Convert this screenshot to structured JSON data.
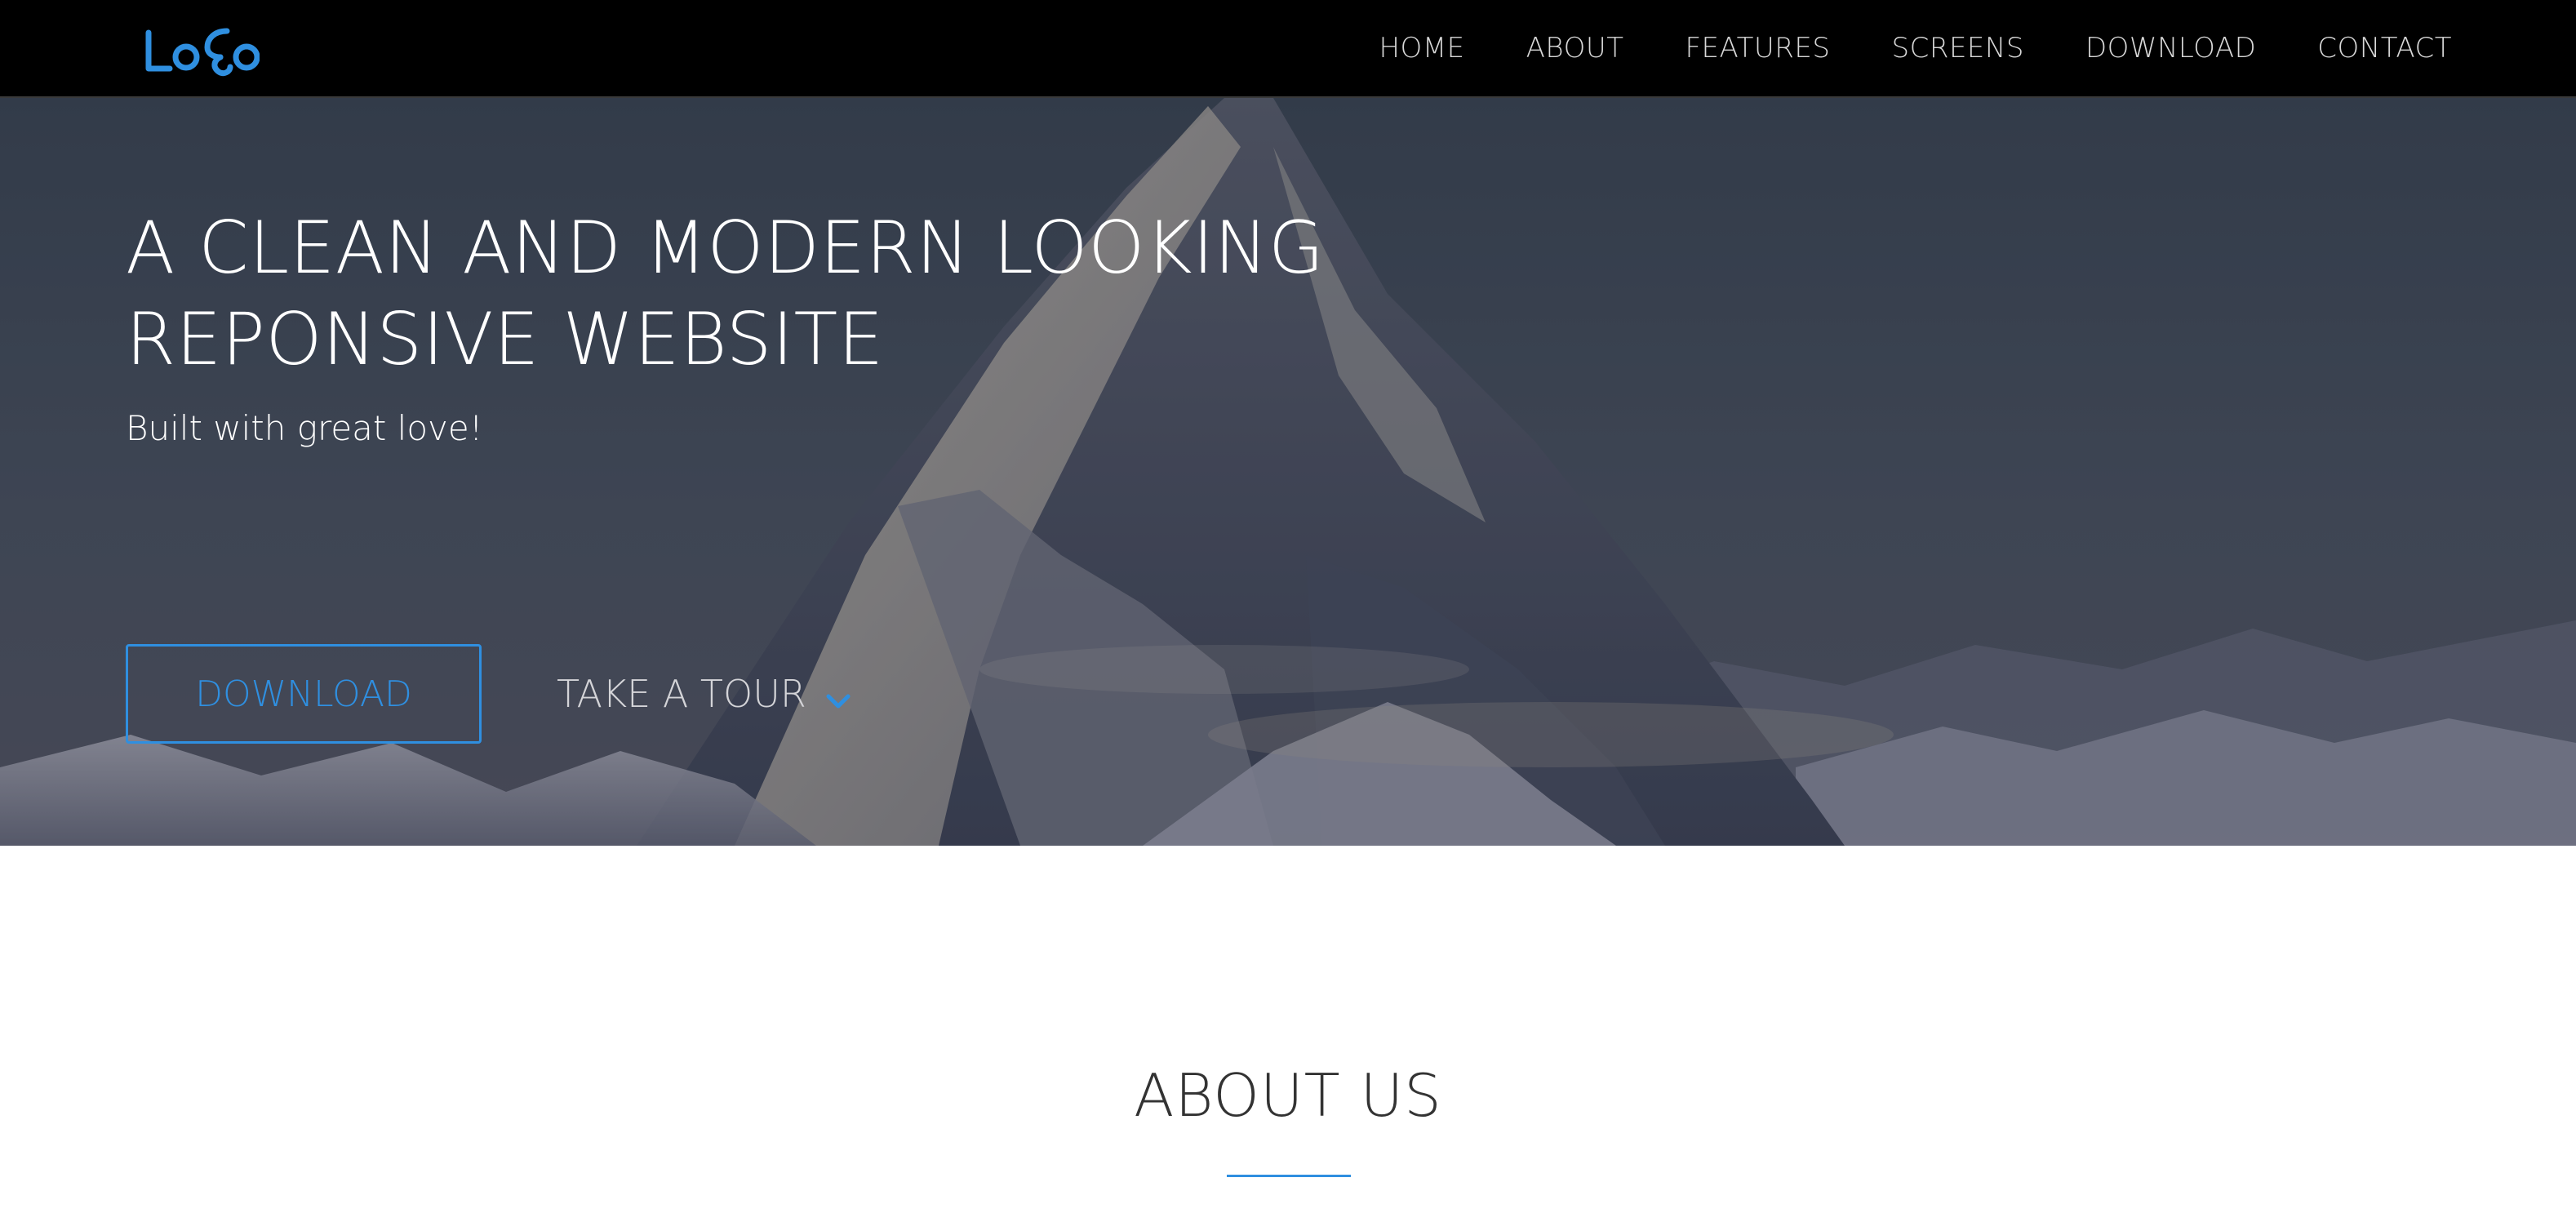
{
  "brand": {
    "logo_text": "LoGo",
    "accent_color": "#2f8fe0"
  },
  "nav": {
    "items": [
      {
        "label": "HOME"
      },
      {
        "label": "ABOUT"
      },
      {
        "label": "FEATURES"
      },
      {
        "label": "SCREENS"
      },
      {
        "label": "DOWNLOAD"
      },
      {
        "label": "CONTACT"
      }
    ]
  },
  "hero": {
    "title_line1": "A CLEAN AND MODERN LOOKING",
    "title_line2": "REPONSIVE WEBSITE",
    "subtitle": "Built with great love!",
    "download_button": "DOWNLOAD",
    "tour_link": "TAKE A TOUR",
    "tour_icon": "chevron-down-icon",
    "background": "mountain-photo"
  },
  "about": {
    "title": "ABOUT US"
  }
}
